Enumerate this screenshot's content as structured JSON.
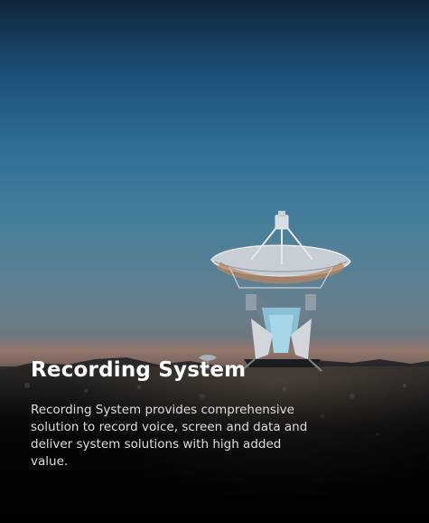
{
  "card": {
    "title": "Recording System",
    "description": "Recording System provides comprehensive solution to record voice, screen and data and deliver system solutions with high added value."
  }
}
